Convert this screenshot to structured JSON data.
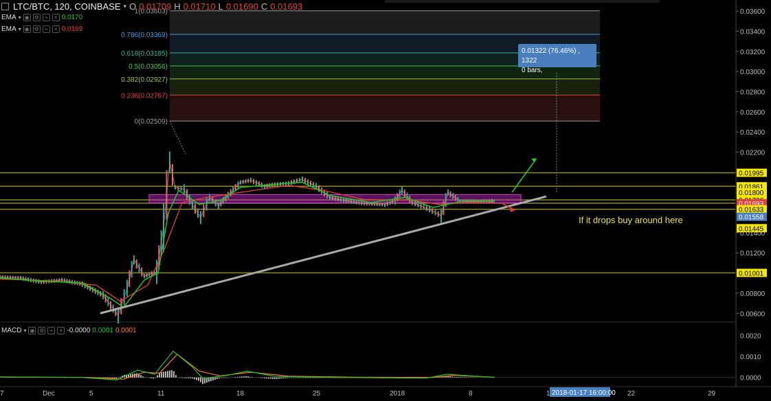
{
  "header": {
    "symbol": "LTC/BTC, 120, COINBASE",
    "open_label": "O",
    "open": "0.01709",
    "high_label": "H",
    "high": "0.01710",
    "low_label": "L",
    "low": "0.01690",
    "close_label": "C",
    "close": "0.01693"
  },
  "indicators": [
    {
      "name": "EMA",
      "value": "0.0170",
      "color": "#22c422"
    },
    {
      "name": "EMA",
      "value": "0.0169",
      "color": "#e0413a"
    }
  ],
  "macd": {
    "name": "MACD",
    "v1": "-0.0000",
    "v2": "0.0001",
    "v3": "0.0001",
    "v2_color": "#22c422",
    "v3_color": "#ff7a2a"
  },
  "measure_tooltip": {
    "line1": "0.01322 (76.46%) , 1322",
    "line2": "0 bars,"
  },
  "annotation": "If it drops buy around here",
  "chart_data": {
    "type": "line",
    "title": "LTC/BTC, 120, COINBASE",
    "y_axis_ticks": [
      "0.03600",
      "0.03400",
      "0.03200",
      "0.03000",
      "0.02800",
      "0.02600",
      "0.02400",
      "0.02200",
      "0.02000",
      "0.01800",
      "0.01600",
      "0.01400",
      "0.01200",
      "0.01000",
      "0.00800",
      "0.00600"
    ],
    "ylim": [
      0.0052,
      0.0371
    ],
    "macd_axis_ticks": [
      "0.0020",
      "0.0010",
      "0.0000"
    ],
    "macd_ylim": [
      -0.0004,
      0.0026
    ],
    "x_axis_ticks": [
      "7",
      "Dec",
      "5",
      "11",
      "18",
      "25",
      "2018",
      "8",
      "15",
      "22",
      "29"
    ],
    "time_label": "2018-01-17 16:00:00",
    "fib_levels": [
      {
        "label": "1(0.03603)",
        "value": 0.03603,
        "color": "#9a9a9a"
      },
      {
        "label": "0.786(0.03369)",
        "value": 0.03369,
        "color": "#4a9ad6"
      },
      {
        "label": "0.618(0.03185)",
        "value": 0.03185,
        "color": "#3ab39a"
      },
      {
        "label": "0.5(0.03056)",
        "value": 0.03056,
        "color": "#4cc24c"
      },
      {
        "label": "0.382(0.02927)",
        "value": 0.02927,
        "color": "#9ac23a"
      },
      {
        "label": "0.236(0.02767)",
        "value": 0.02767,
        "color": "#e0413a"
      },
      {
        "label": "0(0.02509)",
        "value": 0.02509,
        "color": "#9a9a9a"
      }
    ],
    "horizontal_levels": [
      {
        "label": "0.01995",
        "value": 0.01995
      },
      {
        "label": "0.01861",
        "value": 0.01861
      },
      {
        "label": "0.01726",
        "value": 0.01726
      },
      {
        "label": "0.01693",
        "value": 0.01693
      },
      {
        "label": "0.01633",
        "value": 0.01633
      },
      {
        "label": "0.01001",
        "value": 0.01001
      }
    ],
    "price_labels": [
      {
        "label": "0.01995",
        "value": 0.01995,
        "bg": "#f5e700",
        "fg": "#000"
      },
      {
        "label": "0.01861",
        "value": 0.01861,
        "bg": "#f5e700",
        "fg": "#000"
      },
      {
        "label": "0.01800",
        "value": 0.018,
        "bg": "#f5e700",
        "fg": "#000"
      },
      {
        "label": "0.01726",
        "value": 0.01726,
        "bg": "#f5e700",
        "fg": "#000"
      },
      {
        "label": "0.01693",
        "value": 0.01693,
        "bg": "#e0413a",
        "fg": "#fff"
      },
      {
        "label": "01:24:57",
        "value": 0.0161,
        "bg": "#e0413a",
        "fg": "#fff"
      },
      {
        "label": "0.01633",
        "value": 0.01633,
        "bg": "#f5e700",
        "fg": "#000"
      },
      {
        "label": "0.01558",
        "value": 0.01558,
        "bg": "#4a7fbd",
        "fg": "#fff"
      },
      {
        "label": "0.01445",
        "value": 0.01445,
        "bg": "#f5e700",
        "fg": "#000"
      },
      {
        "label": "0.01001",
        "value": 0.01001,
        "bg": "#f5e700",
        "fg": "#000"
      }
    ],
    "price_series": [
      [
        0,
        0.0096
      ],
      [
        30,
        0.0095
      ],
      [
        60,
        0.0091
      ],
      [
        90,
        0.0093
      ],
      [
        120,
        0.0089
      ],
      [
        150,
        0.0078
      ],
      [
        172,
        0.0058
      ],
      [
        185,
        0.0085
      ],
      [
        195,
        0.0113
      ],
      [
        210,
        0.0097
      ],
      [
        228,
        0.0101
      ],
      [
        238,
        0.0145
      ],
      [
        247,
        0.021
      ],
      [
        255,
        0.0185
      ],
      [
        268,
        0.0183
      ],
      [
        280,
        0.0168
      ],
      [
        292,
        0.0155
      ],
      [
        305,
        0.0175
      ],
      [
        318,
        0.0167
      ],
      [
        332,
        0.0177
      ],
      [
        350,
        0.019
      ],
      [
        365,
        0.0192
      ],
      [
        385,
        0.0186
      ],
      [
        400,
        0.0188
      ],
      [
        420,
        0.0189
      ],
      [
        440,
        0.0193
      ],
      [
        460,
        0.0186
      ],
      [
        480,
        0.0175
      ],
      [
        500,
        0.0172
      ],
      [
        530,
        0.0169
      ],
      [
        560,
        0.0168
      ],
      [
        575,
        0.0172
      ],
      [
        585,
        0.0182
      ],
      [
        600,
        0.017
      ],
      [
        625,
        0.0163
      ],
      [
        642,
        0.0157
      ],
      [
        652,
        0.018
      ],
      [
        670,
        0.0171
      ],
      [
        700,
        0.0171
      ],
      [
        720,
        0.0172
      ]
    ],
    "ema_fast": [
      [
        0,
        0.0095
      ],
      [
        60,
        0.0092
      ],
      [
        120,
        0.009
      ],
      [
        160,
        0.0075
      ],
      [
        180,
        0.0066
      ],
      [
        210,
        0.0093
      ],
      [
        230,
        0.01
      ],
      [
        245,
        0.016
      ],
      [
        260,
        0.0182
      ],
      [
        290,
        0.0168
      ],
      [
        320,
        0.0172
      ],
      [
        350,
        0.0185
      ],
      [
        400,
        0.0188
      ],
      [
        440,
        0.019
      ],
      [
        480,
        0.0177
      ],
      [
        540,
        0.017
      ],
      [
        590,
        0.0175
      ],
      [
        630,
        0.0165
      ],
      [
        650,
        0.0168
      ],
      [
        680,
        0.0172
      ],
      [
        720,
        0.0171
      ]
    ],
    "ema_slow": [
      [
        0,
        0.0094
      ],
      [
        80,
        0.0092
      ],
      [
        140,
        0.0088
      ],
      [
        175,
        0.0072
      ],
      [
        215,
        0.0088
      ],
      [
        240,
        0.0125
      ],
      [
        265,
        0.017
      ],
      [
        300,
        0.0175
      ],
      [
        350,
        0.018
      ],
      [
        420,
        0.0187
      ],
      [
        470,
        0.0182
      ],
      [
        530,
        0.0173
      ],
      [
        600,
        0.0172
      ],
      [
        640,
        0.0168
      ],
      [
        680,
        0.017
      ],
      [
        720,
        0.017
      ]
    ],
    "macd_line": [
      [
        0,
        3e-05
      ],
      [
        120,
        0.0
      ],
      [
        170,
        -0.00012
      ],
      [
        200,
        0.00035
      ],
      [
        225,
        0.00015
      ],
      [
        252,
        0.00125
      ],
      [
        280,
        0.0005
      ],
      [
        295,
        -5e-05
      ],
      [
        330,
        0.0001
      ],
      [
        360,
        0.0003
      ],
      [
        400,
        5e-05
      ],
      [
        500,
        0.0
      ],
      [
        620,
        -3e-05
      ],
      [
        650,
        0.00015
      ],
      [
        720,
        0.0
      ]
    ],
    "signal_line": [
      [
        0,
        2e-05
      ],
      [
        130,
        0.0
      ],
      [
        180,
        -8e-05
      ],
      [
        210,
        0.00025
      ],
      [
        232,
        0.0002
      ],
      [
        258,
        0.0011
      ],
      [
        290,
        0.0003
      ],
      [
        320,
        8e-05
      ],
      [
        365,
        0.00025
      ],
      [
        420,
        6e-05
      ],
      [
        520,
        1e-05
      ],
      [
        630,
        0.0
      ],
      [
        660,
        0.0001
      ],
      [
        720,
        1e-05
      ]
    ]
  }
}
